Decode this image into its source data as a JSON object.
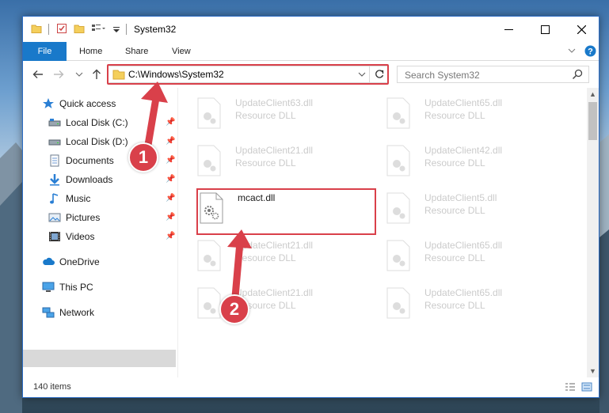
{
  "window": {
    "title": "System32",
    "controls": {
      "minimize": "minimize-icon",
      "maximize": "maximize-icon",
      "close": "close-icon"
    }
  },
  "ribbon": {
    "tabs": [
      {
        "label": "File"
      },
      {
        "label": "Home"
      },
      {
        "label": "Share"
      },
      {
        "label": "View"
      }
    ]
  },
  "navbar": {
    "address": "C:\\Windows\\System32",
    "search_placeholder": "Search System32"
  },
  "sidebar": {
    "items": [
      {
        "label": "Quick access",
        "icon": "star-icon",
        "pinned": false
      },
      {
        "label": "Local Disk (C:)",
        "icon": "drive-icon",
        "pinned": true
      },
      {
        "label": "Local Disk (D:)",
        "icon": "drive-icon",
        "pinned": true
      },
      {
        "label": "Documents",
        "icon": "documents-icon",
        "pinned": true
      },
      {
        "label": "Downloads",
        "icon": "download-icon",
        "pinned": true
      },
      {
        "label": "Music",
        "icon": "music-icon",
        "pinned": true
      },
      {
        "label": "Pictures",
        "icon": "pictures-icon",
        "pinned": true
      },
      {
        "label": "Videos",
        "icon": "videos-icon",
        "pinned": true
      },
      {
        "label": "OneDrive",
        "icon": "cloud-icon",
        "pinned": false
      },
      {
        "label": "This PC",
        "icon": "computer-icon",
        "pinned": false,
        "selected": true
      },
      {
        "label": "Network",
        "icon": "network-icon",
        "pinned": false
      }
    ]
  },
  "files": [
    {
      "name": "UpdateClient63.dll",
      "type": "Resource DLL",
      "faded": true
    },
    {
      "name": "UpdateClient65.dll",
      "type": "Resource DLL",
      "faded": true
    },
    {
      "name": "UpdateClient21.dll",
      "type": "Resource DLL",
      "faded": true
    },
    {
      "name": "UpdateClient42.dll",
      "type": "Resource DLL",
      "faded": true
    },
    {
      "name": "mcact.dll",
      "type": "",
      "faded": false,
      "highlighted": true
    },
    {
      "name": "UpdateClient5.dll",
      "type": "Resource DLL",
      "faded": true
    },
    {
      "name": "UpdateClient21.dll",
      "type": "Resource DLL",
      "faded": true
    },
    {
      "name": "UpdateClient65.dll",
      "type": "Resource DLL",
      "faded": true
    },
    {
      "name": "UpdateClient21.dll",
      "type": "Resource DLL",
      "faded": true
    },
    {
      "name": "UpdateClient65.dll",
      "type": "Resource DLL",
      "faded": true
    }
  ],
  "status": {
    "item_count": "140 items"
  },
  "annotations": [
    {
      "number": "1",
      "color": "#d9404a"
    },
    {
      "number": "2",
      "color": "#d9404a"
    }
  ],
  "colors": {
    "accent": "#1979ca",
    "annotation": "#d9404a",
    "selection": "#d9d9d9"
  }
}
